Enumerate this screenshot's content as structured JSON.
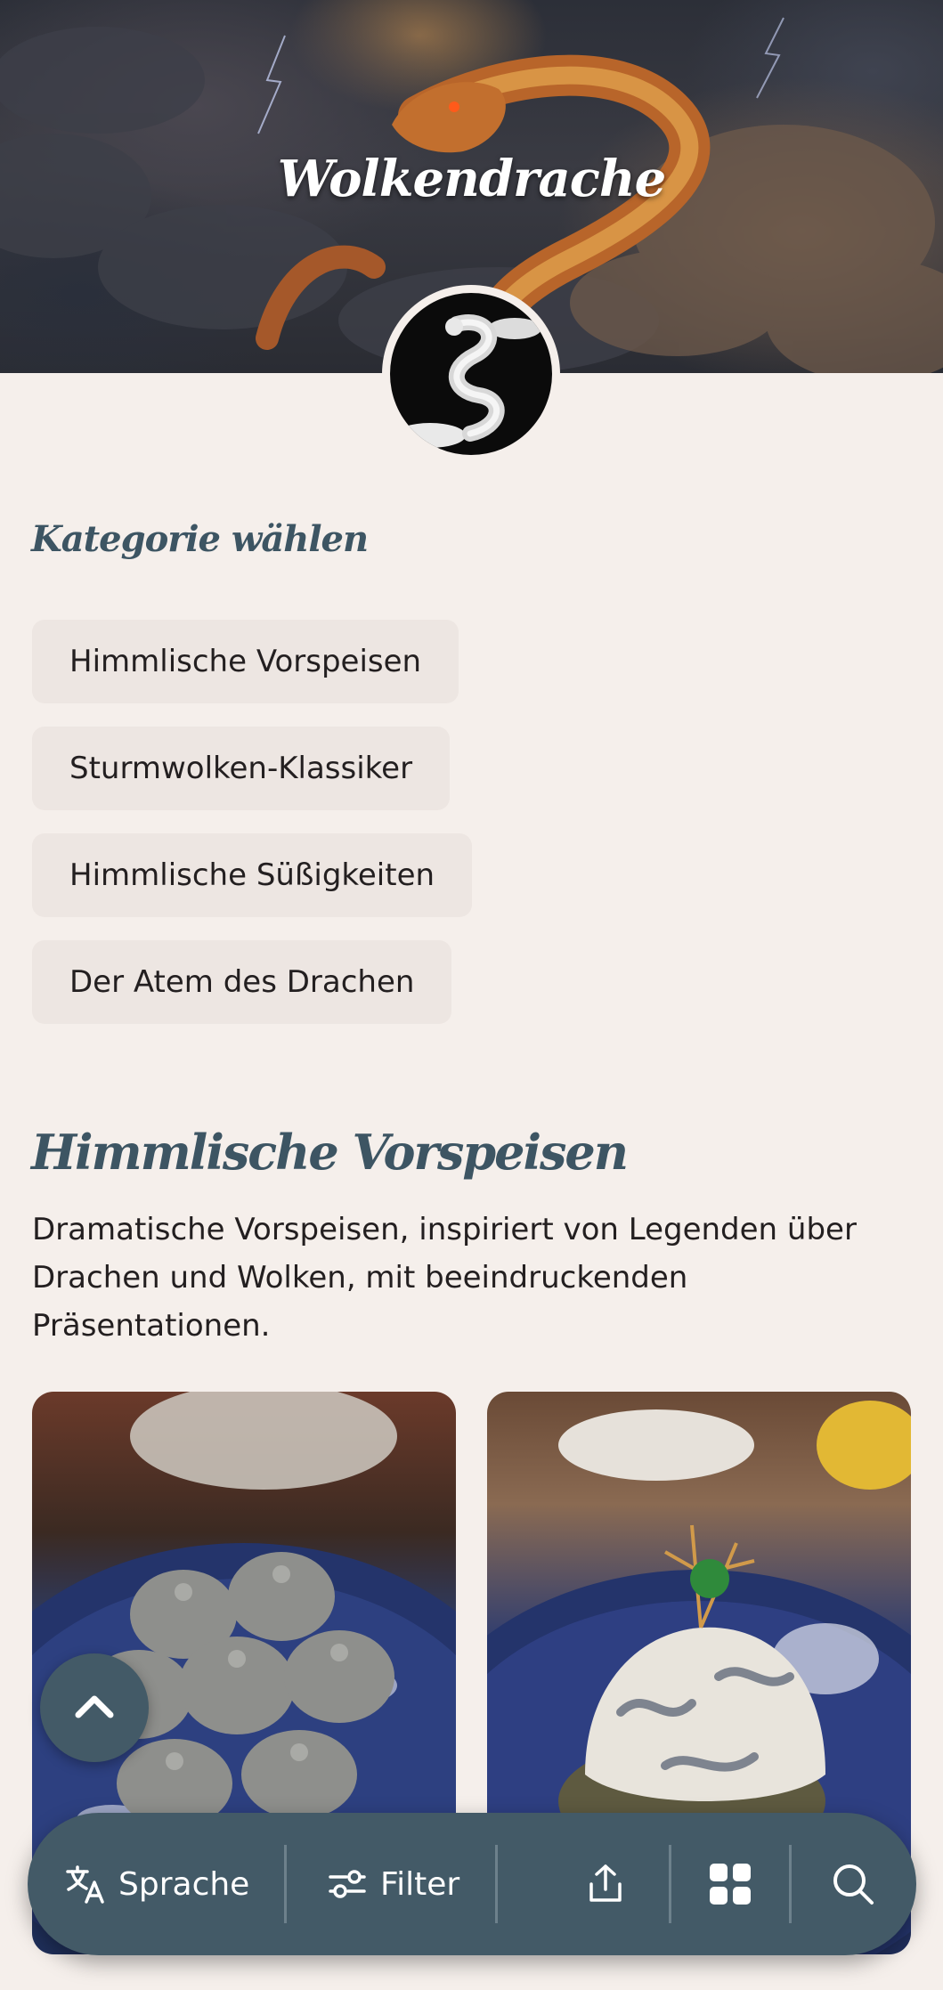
{
  "header": {
    "brand_name": "Wolkendrache"
  },
  "categories": {
    "heading": "Kategorie wählen",
    "items": [
      {
        "label": "Himmlische Vorspeisen"
      },
      {
        "label": "Sturmwolken-Klassiker"
      },
      {
        "label": "Himmlische Süßigkeiten"
      },
      {
        "label": "Der Atem des Drachen"
      }
    ]
  },
  "section": {
    "title": "Himmlische Vorspeisen",
    "description": "Dramatische Vorspeisen, inspiriert von Legenden über Drachen und Wolken, mit beeindruckenden Präsentationen."
  },
  "toolbar": {
    "language_label": "Sprache",
    "language_icon": "translate-icon",
    "filter_label": "Filter",
    "filter_icon": "sliders-icon",
    "share_icon": "share-icon",
    "grid_icon": "grid-icon",
    "search_icon": "search-icon"
  },
  "scroll_top_icon": "chevron-up-icon",
  "colors": {
    "background": "#f5efeb",
    "accent": "#435a67",
    "heading": "#3d5563",
    "chip": "#ede6e2"
  }
}
